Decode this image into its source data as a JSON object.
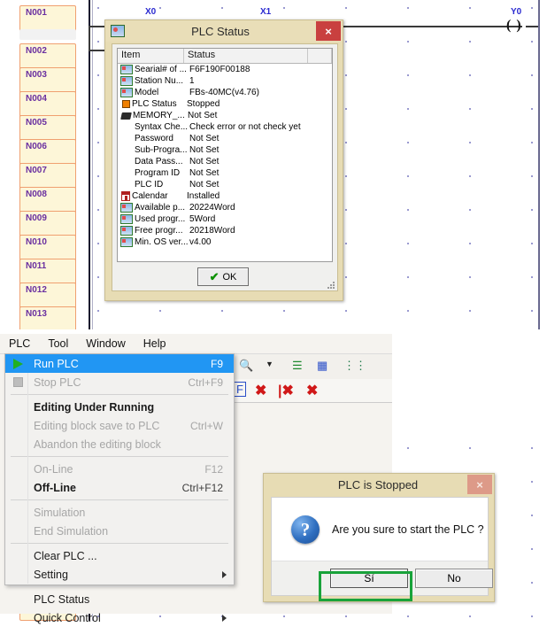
{
  "ladder": {
    "rung_labels": [
      "N001",
      "N002",
      "N003",
      "N004",
      "N005",
      "N006",
      "N007",
      "N008",
      "N009",
      "N010",
      "N011",
      "N012",
      "N013"
    ],
    "contacts_top": [
      {
        "tag": "X0",
        "type": "normally-open-energized"
      },
      {
        "tag": "Y0",
        "type": "normally-open"
      },
      {
        "tag": "X1",
        "type": "normally-open"
      }
    ],
    "coil_top": {
      "tag": "Y0",
      "symbol": "( )"
    },
    "contacts_bottom": [
      {
        "tag": "X1",
        "type": "normally-open"
      }
    ]
  },
  "plc_status_dialog": {
    "title": "PLC Status",
    "icon": "plc-app-icon",
    "close_label": "×",
    "columns": [
      "Item",
      "Status"
    ],
    "rows": [
      {
        "icon": "ic-win",
        "item": "Searial# of ...",
        "status": "F6F190F00188"
      },
      {
        "icon": "ic-win",
        "item": "Station Nu...",
        "status": "1"
      },
      {
        "icon": "ic-win",
        "item": "Model",
        "status": "FBs-40MC(v4.76)"
      },
      {
        "icon": "ic-stop",
        "item": "PLC Status",
        "status": "Stopped"
      },
      {
        "icon": "ic-mem",
        "item": "MEMORY_...",
        "status": "Not Set"
      },
      {
        "icon": "ic-none",
        "item": "Syntax Che...",
        "status": "Check error or not check yet"
      },
      {
        "icon": "ic-none",
        "item": "Password",
        "status": "Not Set"
      },
      {
        "icon": "ic-none",
        "item": "Sub-Progra...",
        "status": "Not Set"
      },
      {
        "icon": "ic-none",
        "item": "Data Pass...",
        "status": "Not Set"
      },
      {
        "icon": "ic-none",
        "item": "Program ID",
        "status": "Not Set"
      },
      {
        "icon": "ic-none",
        "item": "PLC ID",
        "status": "Not Set"
      },
      {
        "icon": "ic-cal",
        "item": "Calendar",
        "status": "Installed"
      },
      {
        "icon": "ic-win",
        "item": "Available p...",
        "status": "20224Word"
      },
      {
        "icon": "ic-win",
        "item": "Used progr...",
        "status": "5Word"
      },
      {
        "icon": "ic-win",
        "item": "Free progr...",
        "status": "20218Word"
      },
      {
        "icon": "ic-win",
        "item": "Min. OS ver...",
        "status": "v4.00"
      }
    ],
    "ok_label": "OK",
    "ok_icon": "check-icon"
  },
  "menubar": {
    "items": [
      "PLC",
      "Tool",
      "Window",
      "Help"
    ]
  },
  "toolbar": {
    "icons": [
      "zoom-search-icon",
      "dropdown-arrow-icon",
      "list-report-icon",
      "grid-report-icon",
      "contact-report-icon",
      "form-icon",
      "delete-red-x-icon",
      "delete-left-x-icon",
      "delete-all-x-icon"
    ]
  },
  "plc_menu": {
    "items": [
      {
        "label": "Run PLC",
        "shortcut": "F9",
        "state": "selected",
        "icon": "play-icon"
      },
      {
        "label": "Stop PLC",
        "shortcut": "Ctrl+F9",
        "state": "disabled",
        "icon": "stop-icon"
      },
      {
        "separator": true
      },
      {
        "label": "Editing Under Running",
        "shortcut": "",
        "state": "bold"
      },
      {
        "label": "Editing block save to PLC",
        "shortcut": "Ctrl+W",
        "state": "disabled"
      },
      {
        "label": "Abandon the editing block",
        "shortcut": "",
        "state": "disabled"
      },
      {
        "separator": true
      },
      {
        "label": "On-Line",
        "shortcut": "F12",
        "state": "disabled"
      },
      {
        "label": "Off-Line",
        "shortcut": "Ctrl+F12",
        "state": "bold"
      },
      {
        "separator": true
      },
      {
        "label": "Simulation",
        "shortcut": "",
        "state": "disabled"
      },
      {
        "label": "End Simulation",
        "shortcut": "",
        "state": "disabled"
      },
      {
        "separator": true
      },
      {
        "label": "Clear PLC ...",
        "shortcut": "",
        "state": "normal"
      },
      {
        "label": "Setting",
        "shortcut": "",
        "state": "normal",
        "submenu": true
      },
      {
        "separator": true
      },
      {
        "label": "PLC Status",
        "shortcut": "",
        "state": "normal"
      },
      {
        "label": "Quick Control",
        "shortcut": "",
        "state": "normal",
        "submenu": true
      }
    ]
  },
  "confirm_dialog": {
    "title": "PLC is Stopped",
    "close_label": "×",
    "icon": "question-icon",
    "message": "Are you sure to start the PLC ?",
    "yes_label": "Sí",
    "no_label": "No",
    "highlight_color": "#19a33a"
  }
}
